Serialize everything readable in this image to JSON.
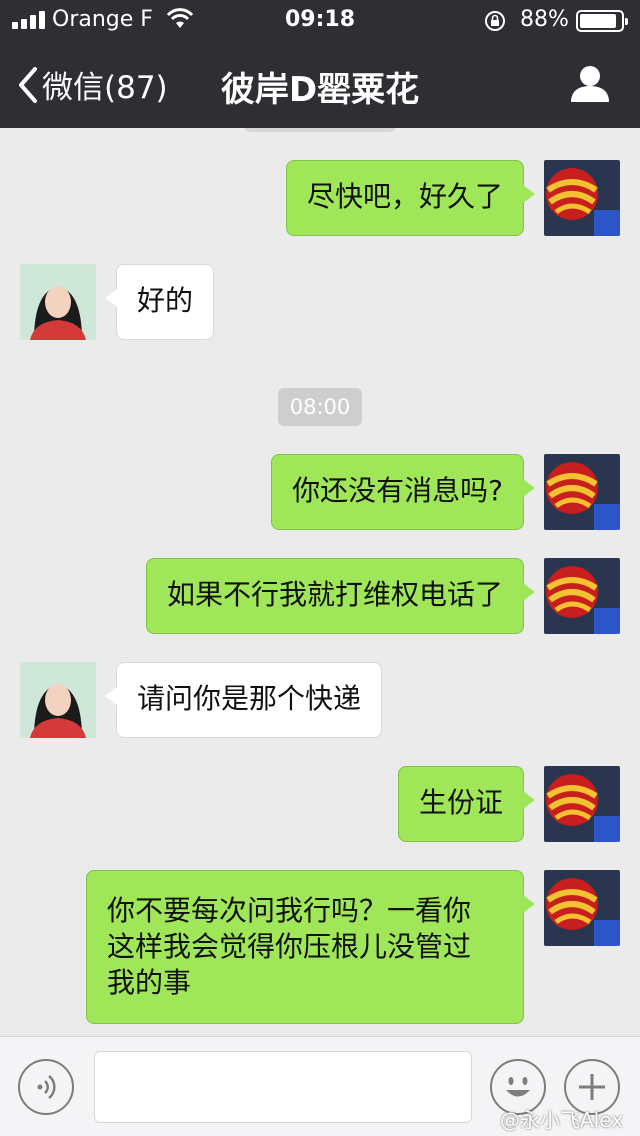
{
  "status": {
    "carrier": "Orange F",
    "time": "09:18",
    "battery": "88%"
  },
  "nav": {
    "back_label": "微信(87)",
    "title": "彼岸D罂粟花"
  },
  "messages": [
    {
      "sender": "me",
      "text": "尽快吧，好久了"
    },
    {
      "sender": "her",
      "text": "好的"
    },
    {
      "sender": "me",
      "text": "你还没有消息吗?"
    },
    {
      "sender": "me",
      "text": "如果不行我就打维权电话了"
    },
    {
      "sender": "her",
      "text": "请问你是那个快递"
    },
    {
      "sender": "me",
      "text": "生份证"
    },
    {
      "sender": "me",
      "lines": [
        "你不要每次问我行吗？一看你",
        "这样我会觉得你压根儿没管过",
        "我的事"
      ]
    }
  ],
  "timestamp": "08:00",
  "watermark": "@永小飞Alex",
  "icons": {
    "back": "chevron-left-icon",
    "profile": "person-icon",
    "voice": "voice-icon",
    "emoji": "emoji-icon",
    "plus": "plus-icon"
  },
  "colors": {
    "nav_bg": "#2e2e33",
    "chat_bg": "#ebebeb",
    "my_bubble": "#9fe658",
    "her_bubble": "#ffffff"
  }
}
